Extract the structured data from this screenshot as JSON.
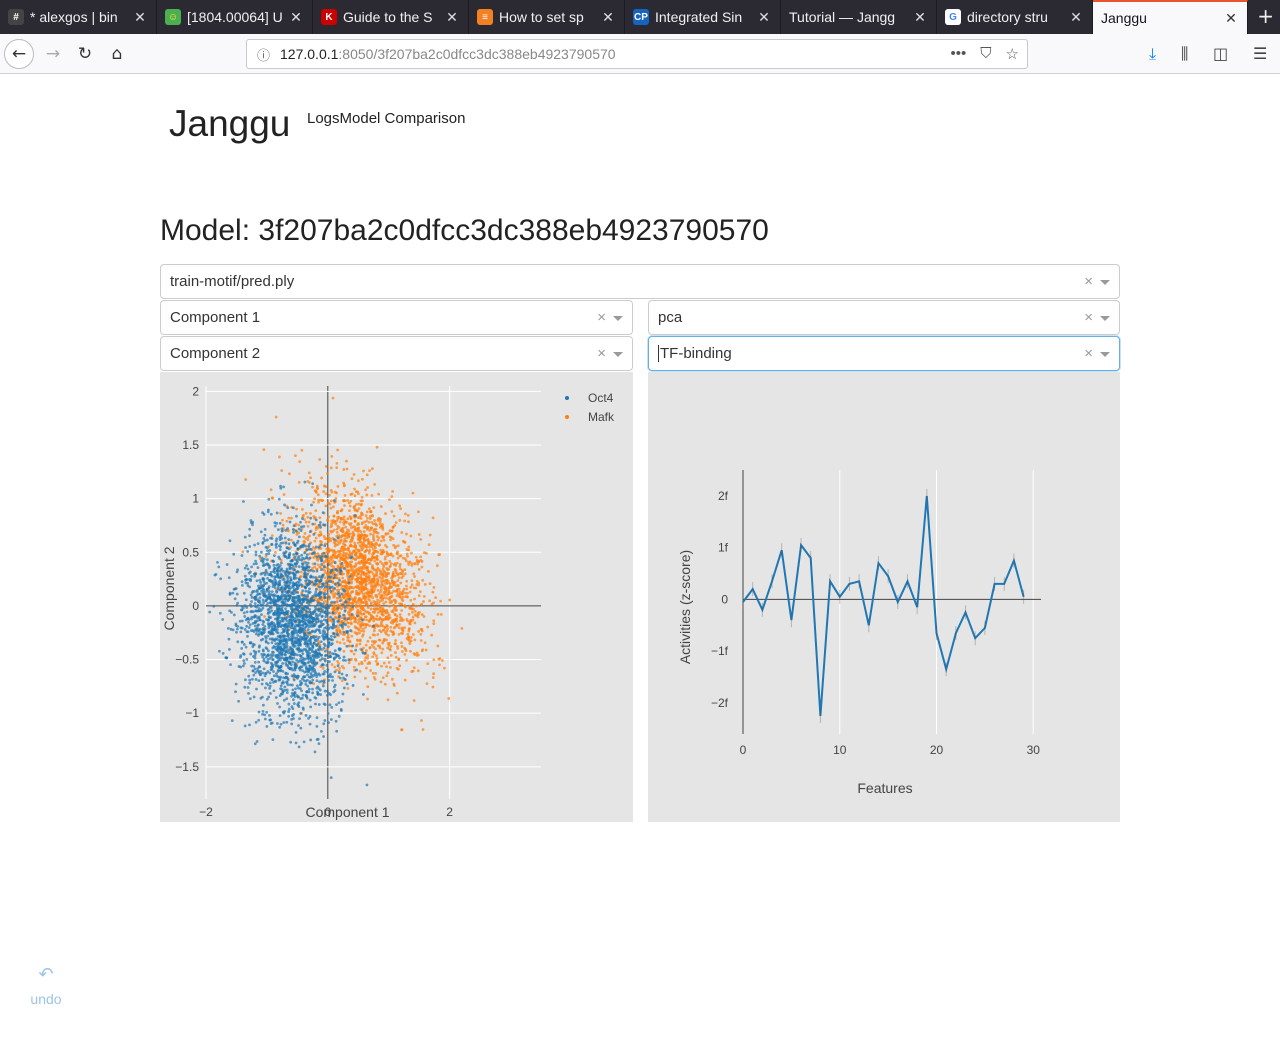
{
  "browser": {
    "tabs": [
      {
        "title": "* alexgos | bin",
        "icon": "hash-icon",
        "color": "#444444",
        "glyph": "#"
      },
      {
        "title": "[1804.00064] U",
        "icon": "smiley-icon",
        "color": "#4caf50",
        "glyph": "☺"
      },
      {
        "title": "Guide to the S",
        "icon": "k-icon",
        "color": "#cc0000",
        "glyph": "K"
      },
      {
        "title": "How to set sp",
        "icon": "stackoverflow-icon",
        "color": "#f48024",
        "glyph": "≡"
      },
      {
        "title": "Integrated Sin",
        "icon": "cp-icon",
        "color": "#1565c0",
        "glyph": "CP"
      },
      {
        "title": "Tutorial — Jangg",
        "icon": "doc-icon",
        "color": "#2b2a33",
        "glyph": ""
      },
      {
        "title": "directory stru",
        "icon": "google-icon",
        "color": "#ffffff",
        "glyph": "G"
      },
      {
        "title": "Janggu",
        "icon": "blank-icon",
        "color": "#f9f9fb",
        "glyph": ""
      }
    ],
    "new_tab": "+",
    "url_host": "127.0.0.1",
    "url_rest": ":8050/3f207ba2c0dfcc3dc388eb4923790570"
  },
  "page": {
    "brand": "Janggu",
    "nav_logs": "Logs",
    "nav_compare": "Model Comparison",
    "model_title": "Model: 3f207ba2c0dfcc3dc388eb4923790570",
    "select_file": "train-motif/pred.ply",
    "select_x": "Component 1",
    "select_method": "pca",
    "select_y": "Component 2",
    "select_output": "TF-binding",
    "clear": "×",
    "undo_label": "undo",
    "undo_icon": "↶"
  },
  "chart_data": [
    {
      "type": "scatter",
      "xlabel": "Component 1",
      "ylabel": "Component 2",
      "xlim": [
        -2,
        3.5
      ],
      "ylim": [
        -1.8,
        2.05
      ],
      "x_ticks": [
        -2,
        0,
        2
      ],
      "x_tick_labels": [
        "−2",
        "0",
        "2"
      ],
      "y_ticks": [
        -1.5,
        -1,
        -0.5,
        0,
        0.5,
        1,
        1.5,
        2
      ],
      "y_tick_labels": [
        "−1.5",
        "−1",
        "−0.5",
        "0",
        "0.5",
        "1",
        "1.5",
        "2"
      ],
      "legend": "top-right",
      "series": [
        {
          "name": "Oct4",
          "color": "#1f77b4",
          "center": [
            -0.6,
            -0.15
          ],
          "spread": [
            0.45,
            0.4
          ],
          "rotation_deg": -40,
          "count": 2200
        },
        {
          "name": "Mafk",
          "color": "#ff7f0e",
          "center": [
            0.5,
            0.25
          ],
          "spread": [
            0.55,
            0.38
          ],
          "rotation_deg": -25,
          "count": 2200
        }
      ]
    },
    {
      "type": "line",
      "xlabel": "Features",
      "ylabel": "Activities (z-score)",
      "xlim": [
        0,
        30.8
      ],
      "ylim": [
        -2.6,
        2.5
      ],
      "x_ticks": [
        0,
        10,
        20,
        30
      ],
      "x_tick_labels": [
        "0",
        "10",
        "20",
        "30"
      ],
      "y_ticks": [
        -2,
        -1,
        0,
        1,
        2
      ],
      "y_tick_labels": [
        "−2f",
        "−1f",
        "0",
        "1f",
        "2f"
      ],
      "series": [
        {
          "name": "",
          "color": "#1f77b4",
          "x": [
            0,
            1,
            2,
            3,
            4,
            5,
            6,
            7,
            8,
            9,
            10,
            11,
            12,
            13,
            14,
            15,
            16,
            17,
            18,
            19,
            20,
            21,
            22,
            23,
            24,
            25,
            26,
            27,
            28,
            29
          ],
          "y": [
            -0.05,
            0.2,
            -0.2,
            0.35,
            0.95,
            -0.4,
            1.05,
            0.8,
            -2.25,
            0.35,
            0.05,
            0.3,
            0.35,
            -0.5,
            0.7,
            0.45,
            -0.05,
            0.35,
            -0.15,
            2.0,
            -0.65,
            -1.35,
            -0.65,
            -0.25,
            -0.75,
            -0.55,
            0.3,
            0.3,
            0.75,
            0.05
          ]
        }
      ]
    }
  ]
}
